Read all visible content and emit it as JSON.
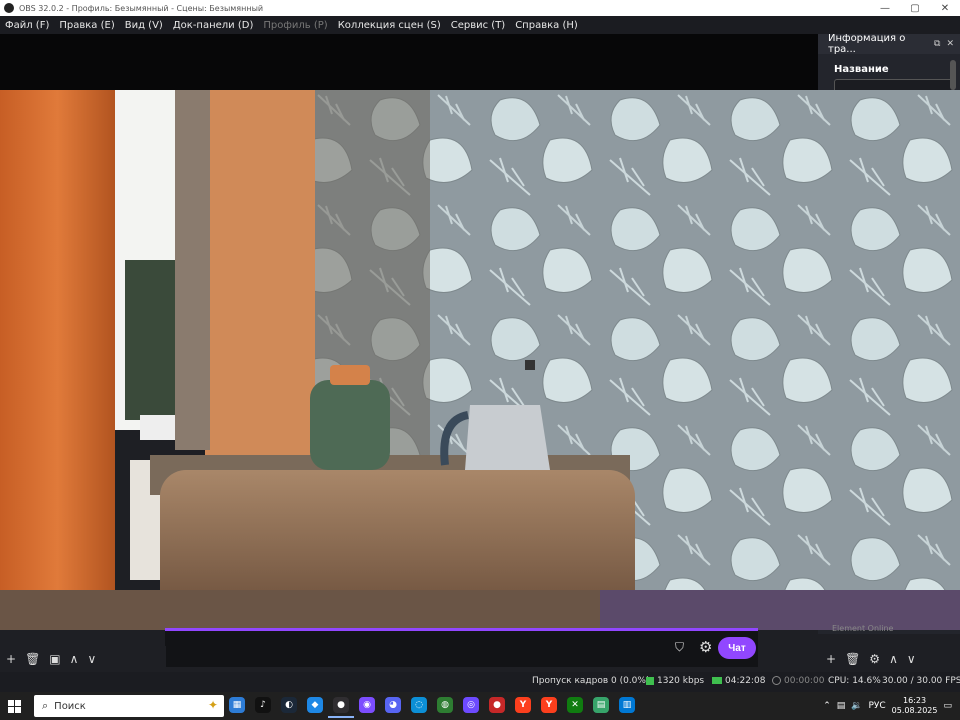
{
  "window": {
    "title": "OBS 32.0.2 - Профиль: Безымянный - Сцены: Безымянный",
    "controls": [
      "—",
      "▢",
      "✕"
    ]
  },
  "menu": [
    {
      "label": "Файл (F)",
      "enabled": true
    },
    {
      "label": "Правка (E)",
      "enabled": true
    },
    {
      "label": "Вид (V)",
      "enabled": true
    },
    {
      "label": "Док-панели (D)",
      "enabled": true
    },
    {
      "label": "Профиль (P)",
      "enabled": false
    },
    {
      "label": "Коллекция сцен (S)",
      "enabled": true
    },
    {
      "label": "Сервис (T)",
      "enabled": true
    },
    {
      "label": "Справка (H)",
      "enabled": true
    }
  ],
  "right_panel": {
    "header": "Информация о тра...",
    "field_label": "Название",
    "hint": "Element Online"
  },
  "nested_preview": {
    "chip": "Информация о тра..."
  },
  "chat": {
    "button_label": "Чат",
    "accent": "#9147ff"
  },
  "scenes_toolbar": [
    "+",
    "🗑",
    "▣",
    "∧",
    "∨"
  ],
  "sources_toolbar": [
    "+",
    "🗑",
    "⚙",
    "∧",
    "∨"
  ],
  "status": {
    "dropped_frames": "Пропуск кадров 0 (0.0%)",
    "bitrate": "1320 kbps",
    "live_time": "04:22:08",
    "rec_time": "00:00:00",
    "cpu": "CPU: 14.6%",
    "fps": "30.00 / 30.00 FPS"
  },
  "taskbar": {
    "search_placeholder": "Поиск",
    "language": "РУС",
    "time": "16:23",
    "date": "05.08.2025",
    "apps": [
      {
        "name": "file-explorer-icon",
        "glyph": "▦",
        "color": "#2d7cd6"
      },
      {
        "name": "tiktok-icon",
        "glyph": "♪",
        "color": "#111"
      },
      {
        "name": "steam-icon",
        "glyph": "◐",
        "color": "#1b2838"
      },
      {
        "name": "blue-app-icon",
        "glyph": "◆",
        "color": "#1e88e5"
      },
      {
        "name": "obs-icon",
        "glyph": "●",
        "color": "#302e31"
      },
      {
        "name": "purple-app-icon",
        "glyph": "◉",
        "color": "#7c4dff"
      },
      {
        "name": "discord-icon",
        "glyph": "◕",
        "color": "#5865f2"
      },
      {
        "name": "edge-icon",
        "glyph": "◌",
        "color": "#0c8fd6"
      },
      {
        "name": "browser-icon",
        "glyph": "◍",
        "color": "#2e7d32"
      },
      {
        "name": "proton-icon",
        "glyph": "◎",
        "color": "#6d4aff"
      },
      {
        "name": "record-app-icon",
        "glyph": "●",
        "color": "#c62828"
      },
      {
        "name": "yandex-icon",
        "glyph": "Y",
        "color": "#fc3f1d"
      },
      {
        "name": "yandex-browser-icon",
        "glyph": "Y",
        "color": "#fc3f1d"
      },
      {
        "name": "xbox-icon",
        "glyph": "✕",
        "color": "#107c10"
      },
      {
        "name": "notes-icon",
        "glyph": "▤",
        "color": "#37a46a"
      },
      {
        "name": "photos-icon",
        "glyph": "▥",
        "color": "#0078d4"
      }
    ]
  }
}
